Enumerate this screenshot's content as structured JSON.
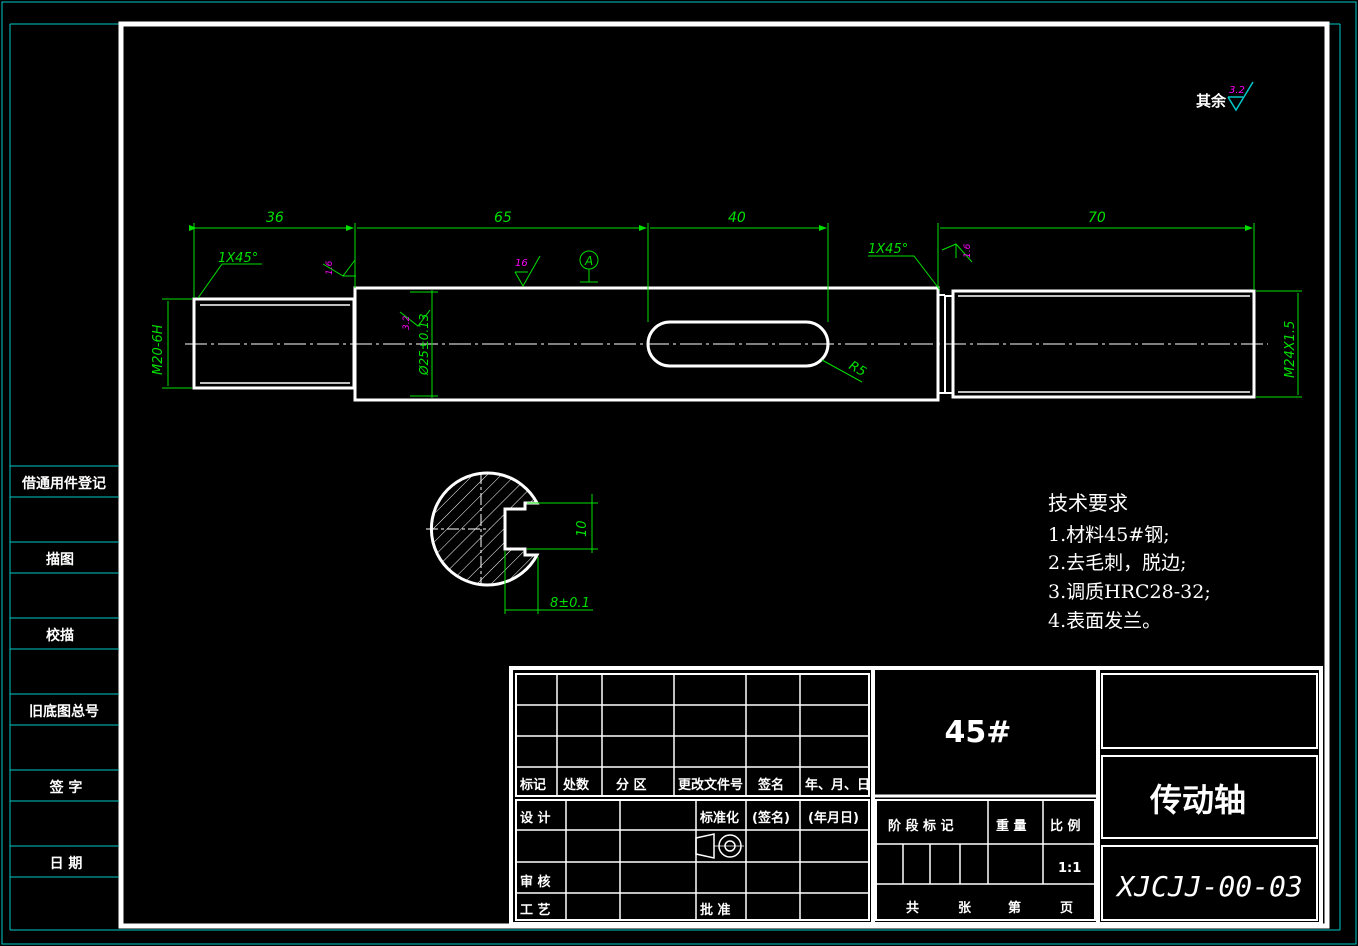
{
  "side_panel": {
    "items": [
      "借通用件登记",
      "描图",
      "校描",
      "旧底图总号",
      "签 字",
      "日 期"
    ]
  },
  "surface_roughness": {
    "prefix": "其余",
    "general_value": "3.2",
    "value_16": "16",
    "value_3_2": "3.2",
    "value_1_6_a": "1.6",
    "value_1_6_b": "1.6"
  },
  "datum": {
    "label": "A"
  },
  "dimensions": {
    "len_36": "36",
    "len_65": "65",
    "len_40": "40",
    "len_70": "70",
    "chamfer_left": "1X45°",
    "chamfer_right": "1X45°",
    "thread_left": "M20-6H",
    "dia_mid": "Ø25±0.13",
    "thread_right": "M24X1.5",
    "radius": "R5",
    "section_width": "10",
    "section_depth": "8±0.1"
  },
  "technical_requirements": {
    "title": "技术要求",
    "items": [
      "1.材料45#钢;",
      "2.去毛刺，脱边;",
      "3.调质HRC28-32;",
      "4.表面发兰。"
    ]
  },
  "title_block": {
    "rev_headers": [
      "标记",
      "处数",
      "分 区",
      "更改文件号",
      "签名",
      "年、月、日"
    ],
    "sign_rows": {
      "design": "设 计",
      "standardize": "标准化",
      "signature": "(签名)",
      "date": "(年月日)",
      "review": "审 核",
      "process": "工 艺",
      "approve": "批 准"
    },
    "material": "45#",
    "stage_headers": [
      "阶 段 标 记",
      "重 量",
      "比 例"
    ],
    "scale": "1:1",
    "sheet_info": [
      "共",
      "张",
      "第",
      "页"
    ],
    "part_name": "传动轴",
    "drawing_number": "XJCJJ-00-03"
  },
  "colors": {
    "background": "#000000",
    "outline": "#ffffff",
    "dimension": "#00e000",
    "frame": "#00c8c8",
    "roughness": "#ff00ff"
  }
}
